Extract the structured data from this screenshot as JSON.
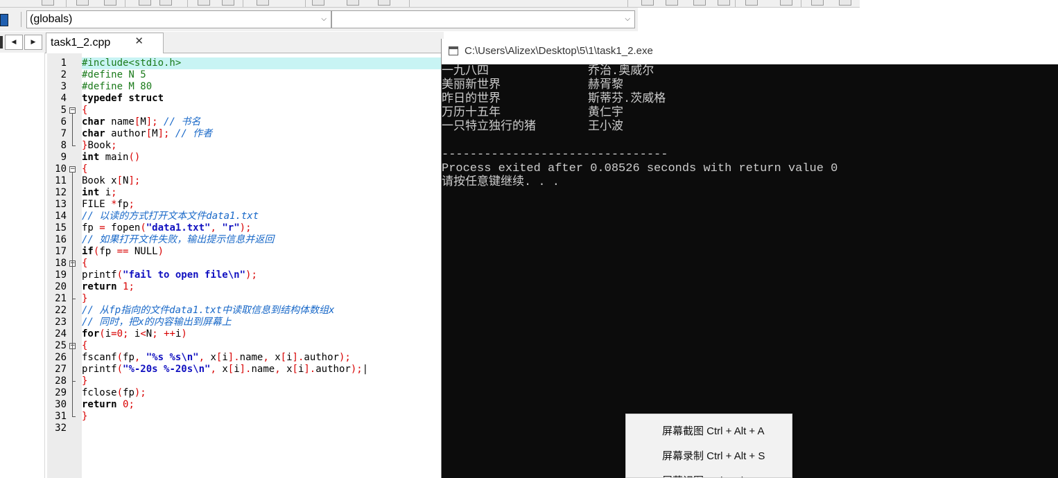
{
  "toolbar": {
    "scope_combo": "(globals)",
    "member_combo": ""
  },
  "tabs": [
    {
      "label": "task1_2.cpp",
      "close": "✕"
    }
  ],
  "nav": {
    "prev": "◀",
    "next": "▶"
  },
  "editor": {
    "lines": [
      {
        "n": "1",
        "tokens": [
          [
            "pre",
            "#include<stdio.h>"
          ]
        ]
      },
      {
        "n": "2",
        "tokens": [
          [
            "pre",
            "#define N 5"
          ]
        ]
      },
      {
        "n": "3",
        "tokens": [
          [
            "pre",
            "#define M 80"
          ]
        ]
      },
      {
        "n": "4",
        "tokens": [
          [
            "kw",
            "typedef struct"
          ]
        ]
      },
      {
        "n": "5",
        "tokens": [
          [
            "sym",
            "{"
          ]
        ]
      },
      {
        "n": "6",
        "tokens": [
          [
            "kw",
            "char"
          ],
          [
            "txt",
            " name"
          ],
          [
            "sym",
            "["
          ],
          [
            "txt",
            "M"
          ],
          [
            "sym",
            "];"
          ],
          [
            "cm",
            " // 书名"
          ]
        ]
      },
      {
        "n": "7",
        "tokens": [
          [
            "kw",
            "char"
          ],
          [
            "txt",
            " author"
          ],
          [
            "sym",
            "["
          ],
          [
            "txt",
            "M"
          ],
          [
            "sym",
            "];"
          ],
          [
            "cm",
            " // 作者"
          ]
        ]
      },
      {
        "n": "8",
        "tokens": [
          [
            "sym",
            "}"
          ],
          [
            "txt",
            "Book"
          ],
          [
            "sym",
            ";"
          ]
        ]
      },
      {
        "n": "9",
        "tokens": [
          [
            "kw",
            "int"
          ],
          [
            "txt",
            " main"
          ],
          [
            "sym",
            "()"
          ]
        ]
      },
      {
        "n": "10",
        "tokens": [
          [
            "sym",
            "{"
          ]
        ]
      },
      {
        "n": "11",
        "tokens": [
          [
            "txt",
            "Book x"
          ],
          [
            "sym",
            "["
          ],
          [
            "txt",
            "N"
          ],
          [
            "sym",
            "];"
          ]
        ]
      },
      {
        "n": "12",
        "tokens": [
          [
            "kw",
            "int"
          ],
          [
            "txt",
            " i"
          ],
          [
            "sym",
            ";"
          ]
        ]
      },
      {
        "n": "13",
        "tokens": [
          [
            "txt",
            "FILE "
          ],
          [
            "sym",
            "*"
          ],
          [
            "txt",
            "fp"
          ],
          [
            "sym",
            ";"
          ]
        ]
      },
      {
        "n": "14",
        "tokens": [
          [
            "cm",
            "// 以读的方式打开文本文件data1.txt"
          ]
        ]
      },
      {
        "n": "15",
        "tokens": [
          [
            "txt",
            "fp "
          ],
          [
            "sym",
            "="
          ],
          [
            "txt",
            " fopen"
          ],
          [
            "sym",
            "("
          ],
          [
            "str",
            "\"data1.txt\""
          ],
          [
            "sym",
            ","
          ],
          [
            "txt",
            " "
          ],
          [
            "str",
            "\"r\""
          ],
          [
            "sym",
            ");"
          ]
        ]
      },
      {
        "n": "16",
        "tokens": [
          [
            "cm",
            "// 如果打开文件失败，输出提示信息并返回"
          ]
        ]
      },
      {
        "n": "17",
        "tokens": [
          [
            "kw",
            "if"
          ],
          [
            "sym",
            "("
          ],
          [
            "txt",
            "fp "
          ],
          [
            "sym",
            "=="
          ],
          [
            "txt",
            " NULL"
          ],
          [
            "sym",
            ")"
          ]
        ]
      },
      {
        "n": "18",
        "tokens": [
          [
            "sym",
            "{"
          ]
        ]
      },
      {
        "n": "19",
        "tokens": [
          [
            "txt",
            "printf"
          ],
          [
            "sym",
            "("
          ],
          [
            "str",
            "\"fail to open file\\n\""
          ],
          [
            "sym",
            ");"
          ]
        ]
      },
      {
        "n": "20",
        "tokens": [
          [
            "kw",
            "return"
          ],
          [
            "txt",
            " "
          ],
          [
            "num",
            "1"
          ],
          [
            "sym",
            ";"
          ]
        ]
      },
      {
        "n": "21",
        "tokens": [
          [
            "sym",
            "}"
          ]
        ]
      },
      {
        "n": "22",
        "tokens": [
          [
            "cm",
            "// 从fp指向的文件data1.txt中读取信息到结构体数组x"
          ]
        ]
      },
      {
        "n": "23",
        "tokens": [
          [
            "cm",
            "// 同时，把x的内容输出到屏幕上"
          ]
        ]
      },
      {
        "n": "24",
        "tokens": [
          [
            "kw",
            "for"
          ],
          [
            "sym",
            "("
          ],
          [
            "txt",
            "i"
          ],
          [
            "sym",
            "="
          ],
          [
            "num",
            "0"
          ],
          [
            "sym",
            ";"
          ],
          [
            "txt",
            " i"
          ],
          [
            "sym",
            "<"
          ],
          [
            "txt",
            "N"
          ],
          [
            "sym",
            ";"
          ],
          [
            "txt",
            " "
          ],
          [
            "sym",
            "++"
          ],
          [
            "txt",
            "i"
          ],
          [
            "sym",
            ")"
          ]
        ]
      },
      {
        "n": "25",
        "tokens": [
          [
            "sym",
            "{"
          ]
        ]
      },
      {
        "n": "26",
        "tokens": [
          [
            "txt",
            "fscanf"
          ],
          [
            "sym",
            "("
          ],
          [
            "txt",
            "fp"
          ],
          [
            "sym",
            ","
          ],
          [
            "txt",
            " "
          ],
          [
            "str",
            "\"%s %s\\n\""
          ],
          [
            "sym",
            ","
          ],
          [
            "txt",
            " x"
          ],
          [
            "sym",
            "["
          ],
          [
            "txt",
            "i"
          ],
          [
            "sym",
            "]."
          ],
          [
            "txt",
            "name"
          ],
          [
            "sym",
            ","
          ],
          [
            "txt",
            " x"
          ],
          [
            "sym",
            "["
          ],
          [
            "txt",
            "i"
          ],
          [
            "sym",
            "]."
          ],
          [
            "txt",
            "author"
          ],
          [
            "sym",
            ");"
          ]
        ]
      },
      {
        "n": "27",
        "tokens": [
          [
            "txt",
            "printf"
          ],
          [
            "sym",
            "("
          ],
          [
            "str",
            "\"%-20s %-20s\\n\""
          ],
          [
            "sym",
            ","
          ],
          [
            "txt",
            " x"
          ],
          [
            "sym",
            "["
          ],
          [
            "txt",
            "i"
          ],
          [
            "sym",
            "]."
          ],
          [
            "txt",
            "name"
          ],
          [
            "sym",
            ","
          ],
          [
            "txt",
            " x"
          ],
          [
            "sym",
            "["
          ],
          [
            "txt",
            "i"
          ],
          [
            "sym",
            "]."
          ],
          [
            "txt",
            "author"
          ],
          [
            "sym",
            ");"
          ],
          [
            "txt",
            "|"
          ]
        ]
      },
      {
        "n": "28",
        "tokens": [
          [
            "sym",
            "}"
          ]
        ]
      },
      {
        "n": "29",
        "tokens": [
          [
            "txt",
            "fclose"
          ],
          [
            "sym",
            "("
          ],
          [
            "txt",
            "fp"
          ],
          [
            "sym",
            ");"
          ]
        ]
      },
      {
        "n": "30",
        "tokens": [
          [
            "kw",
            "return"
          ],
          [
            "txt",
            " "
          ],
          [
            "num",
            "0"
          ],
          [
            "sym",
            ";"
          ]
        ]
      },
      {
        "n": "31",
        "tokens": [
          [
            "sym",
            "}"
          ]
        ]
      },
      {
        "n": "32",
        "tokens": []
      }
    ],
    "fold_markers": [
      "5",
      "10",
      "18",
      "25"
    ],
    "highlight_line": "1"
  },
  "console": {
    "title": "C:\\Users\\Alizex\\Desktop\\5\\1\\task1_2.exe",
    "rows": [
      {
        "book": "一九八四",
        "author": "乔治.奥威尔"
      },
      {
        "book": "美丽新世界",
        "author": "赫胥黎"
      },
      {
        "book": "昨日的世界",
        "author": "斯蒂芬.茨威格"
      },
      {
        "book": "万历十五年",
        "author": "黄仁宇"
      },
      {
        "book": "一只特立独行的猪",
        "author": "王小波"
      }
    ],
    "separator": "--------------------------------",
    "exit_line": "Process exited after 0.08526 seconds with return value 0",
    "press_key": "请按任意键继续. . ."
  },
  "context_menu": {
    "items": [
      "屏幕截图 Ctrl + Alt + A",
      "屏幕录制 Ctrl + Alt + S",
      "屏幕识图 Ctrl + Alt + O"
    ]
  }
}
